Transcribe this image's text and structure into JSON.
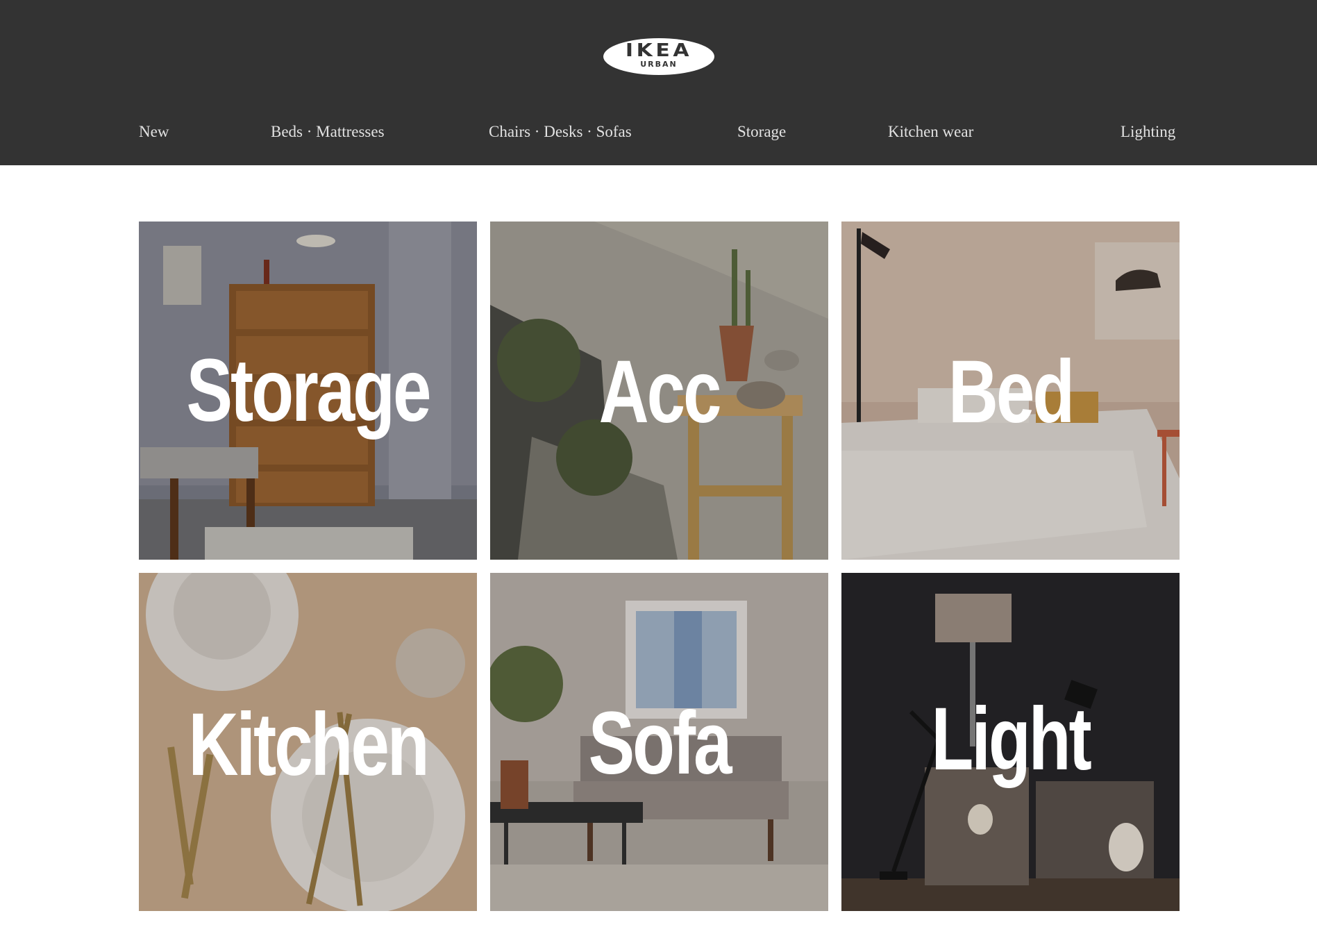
{
  "header": {
    "logo": {
      "main": "IKEA",
      "sub": "URBAN"
    },
    "nav": [
      "New",
      "Beds · Mattresses",
      "Chairs · Desks · Sofas",
      "Storage",
      "Kitchen wear",
      "Lighting"
    ]
  },
  "tiles": [
    {
      "label": "Storage",
      "icon": "dresser-photo"
    },
    {
      "label": "Acc",
      "icon": "plants-photo"
    },
    {
      "label": "Bed",
      "icon": "bedroom-photo"
    },
    {
      "label": "Kitchen",
      "icon": "tableware-photo"
    },
    {
      "label": "Sofa",
      "icon": "living-room-photo"
    },
    {
      "label": "Light",
      "icon": "lamps-photo"
    }
  ],
  "colors": {
    "header_bg": "#333333",
    "nav_text": "#e2e2e2",
    "page_bg": "#ffffff"
  }
}
